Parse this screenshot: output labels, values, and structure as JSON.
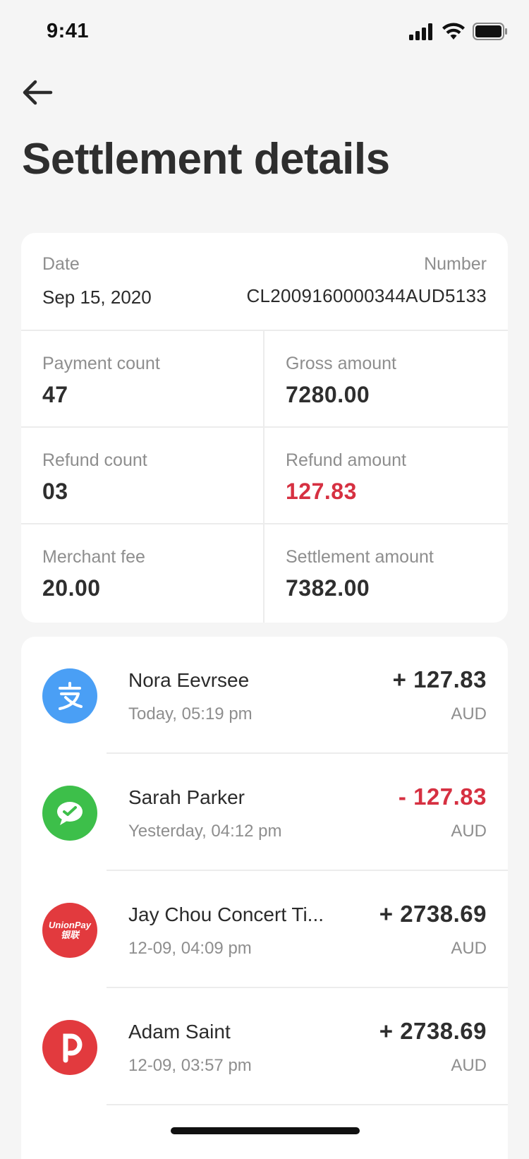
{
  "status_bar": {
    "time": "9:41"
  },
  "header": {
    "title": "Settlement details"
  },
  "summary": {
    "date_label": "Date",
    "date_value": "Sep 15, 2020",
    "number_label": "Number",
    "number_value": "CL2009160000344AUD5133",
    "payment_count_label": "Payment count",
    "payment_count_value": "47",
    "gross_amount_label": "Gross amount",
    "gross_amount_value": "7280.00",
    "refund_count_label": "Refund count",
    "refund_count_value": "03",
    "refund_amount_label": "Refund amount",
    "refund_amount_value": "127.83",
    "merchant_fee_label": "Merchant fee",
    "merchant_fee_value": "20.00",
    "settlement_amount_label": "Settlement amount",
    "settlement_amount_value": "7382.00"
  },
  "transactions": [
    {
      "name": "Nora Eevrsee",
      "time": "Today, 05:19 pm",
      "amount": "+ 127.83",
      "currency": "AUD",
      "method_icon": "alipay-icon",
      "icon_color": "#4a9ff5"
    },
    {
      "name": "Sarah Parker",
      "time": "Yesterday, 04:12 pm",
      "amount": "- 127.83",
      "currency": "AUD",
      "method_icon": "wechat-pay-icon",
      "icon_color": "#3dbf4a",
      "amount_color": "#d63041"
    },
    {
      "name": "Jay Chou Concert Ti...",
      "time": "12-09, 04:09 pm",
      "amount": "+ 2738.69",
      "currency": "AUD",
      "method_icon": "unionpay-icon",
      "icon_color": "#e23a3e",
      "icon_text": "UnionPay",
      "icon_subtext": "银联"
    },
    {
      "name": "Adam Saint",
      "time": "12-09, 03:57 pm",
      "amount": "+ 2738.69",
      "currency": "AUD",
      "method_icon": "australia-post-icon",
      "icon_color": "#e23a3e"
    }
  ],
  "colors": {
    "background": "#f5f5f5",
    "negative": "#d63041",
    "text": "#2e2e2e",
    "muted": "#8e8e8e"
  }
}
